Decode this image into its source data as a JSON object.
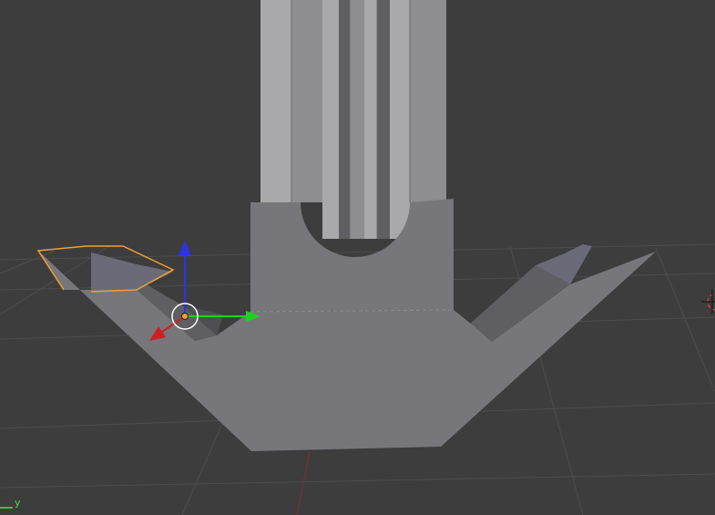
{
  "viewport": {
    "background": "#3d3d3d",
    "grid_color": "#4c4c4c",
    "x_axis_line_color": "#8a2b2b"
  },
  "mesh": {
    "body_color": "#77767b",
    "face_light": "#a9a9ab",
    "face_mid": "#8e8e91",
    "face_dark": "#5f5f63",
    "selected_outline_color": "#f0a030",
    "selected_face_color": "#6a6a78"
  },
  "gizmo": {
    "z_color": "#2d33e6",
    "y_color": "#1fd11f",
    "x_color": "#d11f1f",
    "pivot_color": "#f0a030"
  },
  "cursor_3d": {
    "colors": [
      "#cf3a3a",
      "#ffffff"
    ],
    "crosshair_color": "#111111"
  },
  "axis_indicator": {
    "label": "y",
    "color": "#3ee04a"
  }
}
